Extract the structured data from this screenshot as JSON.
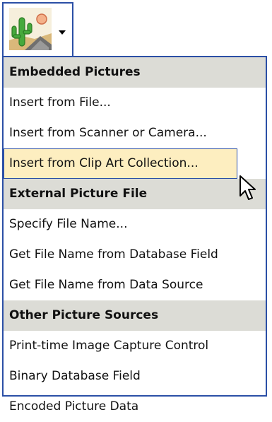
{
  "toolbar": {
    "picture_button_icon": "cactus-desert-clipart-icon",
    "dropdown_icon": "dropdown-arrow-icon"
  },
  "menu": {
    "sections": [
      {
        "header": "Embedded Pictures",
        "items": [
          "Insert from File...",
          "Insert from Scanner or Camera...",
          "Insert from Clip Art Collection..."
        ]
      },
      {
        "header": "External Picture File",
        "items": [
          "Specify File Name...",
          "Get File Name from Database Field",
          "Get File Name from Data Source"
        ]
      },
      {
        "header": "Other Picture Sources",
        "items": [
          "Print-time Image Capture Control",
          "Binary Database Field",
          "Encoded Picture Data"
        ]
      }
    ],
    "highlighted_item": "Insert from Clip Art Collection...",
    "header_background": "#dcdcd6",
    "highlight_background": "#fdeec0",
    "border_color": "#2b4fa6"
  },
  "cursor": {
    "icon": "mouse-pointer-icon"
  }
}
